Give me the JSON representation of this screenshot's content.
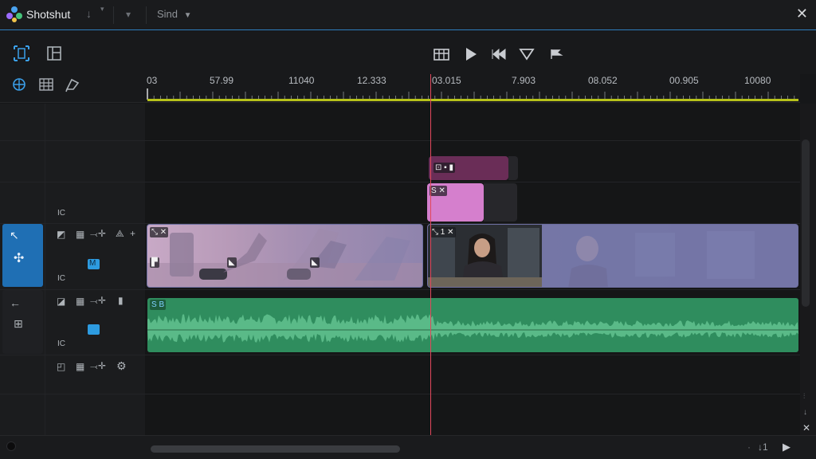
{
  "window": {
    "app_name": "Shotshut",
    "project_dropdown": "Sind",
    "close_glyph": "✕"
  },
  "toolbar": {
    "left_tools": [
      "select-tool-icon",
      "layout-tool-icon"
    ],
    "transport": [
      "trim-icon",
      "play-icon",
      "skip-back-icon",
      "marker-icon",
      "flag-icon"
    ],
    "ruler_tools": [
      "globe-icon",
      "grid-icon",
      "crop-icon"
    ]
  },
  "ruler": {
    "labels": [
      "03",
      "57.99",
      "11040",
      "12.333",
      "03.015",
      "7.903",
      "08.052",
      "00.905",
      "10080"
    ]
  },
  "tracks": {
    "header_labels": {
      "small_tag": "IC",
      "badge": "M"
    }
  },
  "clips": {
    "title_clip_badge": "⊡ ▪ ▮",
    "pink_clip_badge": "S ✕",
    "video1_badge": "⤡ ✕",
    "video2_badge": "⤡ 1 ✕",
    "audio_badge": "S B"
  },
  "bottom": {
    "zoom_label": "↓1"
  },
  "colors": {
    "accent": "#2f80c0",
    "playhead": "#e2485c",
    "ruler_line": "#b7c21a",
    "audio_clip": "#2f8d5e",
    "pink_clip": "#d57fcd",
    "title_clip": "#6a2d57",
    "video_clip": "#7c7ba9"
  }
}
